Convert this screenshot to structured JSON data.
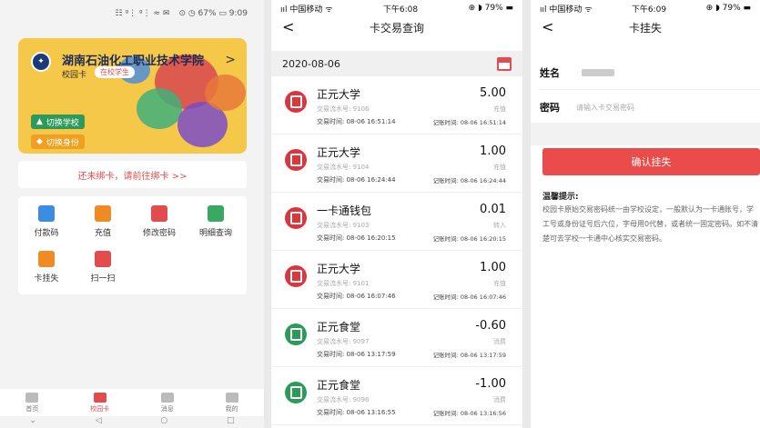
{
  "panel1": {
    "status": {
      "icons": "☷ ᵍ⋮ ᵍ⋮ ≈ ✉",
      "battery": "⊙ ◷ 67% ▭ 9:09"
    },
    "card": {
      "school": "湖南石油化工职业技术学院",
      "type": "校园卡",
      "badge": "在校学生",
      "switch_school": "切换学校",
      "switch_identity": "切换身份",
      "chevron": ">"
    },
    "bind_prompt": "还未绑卡，请前往绑卡 >>",
    "grid": [
      {
        "label": "付款码",
        "icon": "qr-code-icon",
        "color": "#3b8de0"
      },
      {
        "label": "充值",
        "icon": "recharge-icon",
        "color": "#f08a24"
      },
      {
        "label": "修改密码",
        "icon": "lock-icon",
        "color": "#e24c4c"
      },
      {
        "label": "明细查询",
        "icon": "detail-query-icon",
        "color": "#3aa860"
      },
      {
        "label": "卡挂失",
        "icon": "card-loss-icon",
        "color": "#f08a24"
      },
      {
        "label": "扫一扫",
        "icon": "scan-icon",
        "color": "#e24c4c"
      }
    ],
    "tabs": [
      {
        "label": "首页",
        "icon": "home-icon"
      },
      {
        "label": "校园卡",
        "icon": "campus-card-icon"
      },
      {
        "label": "消息",
        "icon": "message-icon"
      },
      {
        "label": "我的",
        "icon": "profile-icon"
      }
    ],
    "active_tab": "校园卡",
    "nav": {
      "down": "⌄",
      "back": "◁",
      "home": "○",
      "recent": "□"
    }
  },
  "panel2": {
    "status": {
      "carrier": "ııl 中国移动 ᯤ",
      "time": "下午6:08",
      "battery": "⊕ ◗ 79% ▬"
    },
    "back": "<",
    "title": "卡交易查询",
    "date": "2020-08-06",
    "transactions": [
      {
        "name": "正元大学",
        "amount": "5.00",
        "serial": "交易流水号: 9106",
        "type": "充值",
        "time": "交易时间: 08-06 16:51:14",
        "posted": "记账时间: 08-06 16:51:14",
        "color": "red"
      },
      {
        "name": "正元大学",
        "amount": "1.00",
        "serial": "交易流水号: 9104",
        "type": "充值",
        "time": "交易时间: 08-06 16:24:44",
        "posted": "记账时间: 08-06 16:24:44",
        "color": "red"
      },
      {
        "name": "一卡通钱包",
        "amount": "0.01",
        "serial": "交易流水号: 9103",
        "type": "转入",
        "time": "交易时间: 08-06 16:20:15",
        "posted": "记账时间: 08-06 16:20:15",
        "color": "red"
      },
      {
        "name": "正元大学",
        "amount": "1.00",
        "serial": "交易流水号: 9101",
        "type": "充值",
        "time": "交易时间: 08-06 16:07:46",
        "posted": "记账时间: 08-06 16:07:46",
        "color": "red"
      },
      {
        "name": "正元食堂",
        "amount": "-0.60",
        "serial": "交易流水号: 9097",
        "type": "消费",
        "time": "交易时间: 08-06 13:17:59",
        "posted": "记账时间: 08-06 13:17:59",
        "color": "green"
      },
      {
        "name": "正元食堂",
        "amount": "-1.00",
        "serial": "交易流水号: 9096",
        "type": "消费",
        "time": "交易时间: 08-06 13:16:55",
        "posted": "记账时间: 08-06 13:16:56",
        "color": "green"
      }
    ]
  },
  "panel3": {
    "status": {
      "carrier": "ııl 中国移动 ᯤ",
      "time": "下午6:09",
      "battery": "⊕ ◗ 79% ▬"
    },
    "back": "<",
    "title": "卡挂失",
    "name_label": "姓名",
    "password_label": "密码",
    "password_placeholder": "请输入卡交易密码",
    "confirm": "确认挂失",
    "tip_title": "温馨提示:",
    "tip_text": "校园卡原始交易密码统一由学校设定，一般默认为一卡通账号，学工号或身份证号后六位，字母用0代替，或者统一固定密码。如不清楚可去学校一卡通中心核实交易密码。"
  }
}
